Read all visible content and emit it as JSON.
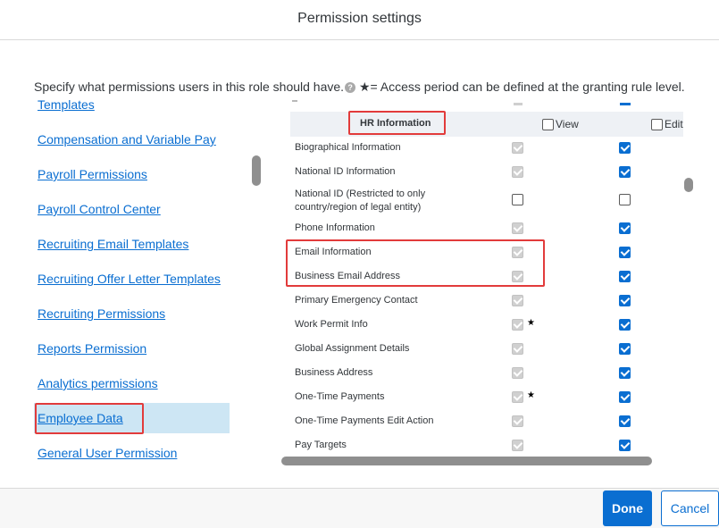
{
  "dialog": {
    "title": "Permission settings"
  },
  "instructions": {
    "text": "Specify what permissions users in this role should have.",
    "help_icon": "?",
    "star_note": "★= Access period can be defined at the granting rule level."
  },
  "left_nav": {
    "items": [
      {
        "label": "Templates",
        "selected": false
      },
      {
        "label": "Compensation and Variable Pay",
        "selected": false
      },
      {
        "label": "Payroll Permissions",
        "selected": false
      },
      {
        "label": "Payroll Control Center",
        "selected": false
      },
      {
        "label": "Recruiting Email Templates",
        "selected": false
      },
      {
        "label": "Recruiting Offer Letter Templates",
        "selected": false
      },
      {
        "label": "Recruiting Permissions",
        "selected": false
      },
      {
        "label": "Reports Permission",
        "selected": false
      },
      {
        "label": "Analytics permissions",
        "selected": false
      },
      {
        "label": "Employee Data",
        "selected": true
      },
      {
        "label": "General User Permission",
        "selected": false
      }
    ]
  },
  "table": {
    "section_title": "HR Information",
    "columns": {
      "view": "View",
      "edit": "Edit"
    },
    "rows": [
      {
        "label": "Biographical Information",
        "view": "gray",
        "edit": "blue",
        "star": ""
      },
      {
        "label": "National ID Information",
        "view": "gray",
        "edit": "blue",
        "star": ""
      },
      {
        "label": "National ID (Restricted to only country/region of legal entity)",
        "view": "empty",
        "edit": "empty",
        "star": ""
      },
      {
        "label": "Phone Information",
        "view": "gray",
        "edit": "blue",
        "star": ""
      },
      {
        "label": "Email Information",
        "view": "gray",
        "edit": "blue",
        "star": ""
      },
      {
        "label": "Business Email Address",
        "view": "gray",
        "edit": "blue",
        "star": ""
      },
      {
        "label": "Primary Emergency Contact",
        "view": "gray",
        "edit": "blue",
        "star": ""
      },
      {
        "label": "Work Permit Info",
        "view": "gray",
        "edit": "blue",
        "star": "★"
      },
      {
        "label": "Global Assignment Details",
        "view": "gray",
        "edit": "blue",
        "star": ""
      },
      {
        "label": "Business Address",
        "view": "gray",
        "edit": "blue",
        "star": ""
      },
      {
        "label": "One-Time Payments",
        "view": "gray",
        "edit": "blue",
        "star": "★"
      },
      {
        "label": "One-Time Payments Edit Action",
        "view": "gray",
        "edit": "blue",
        "star": ""
      },
      {
        "label": "Pay Targets",
        "view": "gray",
        "edit": "blue",
        "star": ""
      }
    ]
  },
  "footer": {
    "done_label": "Done",
    "cancel_label": "Cancel"
  },
  "colors": {
    "accent": "#0a6ed1",
    "highlight": "#e23b3b",
    "selected_bg": "#cde6f4"
  }
}
